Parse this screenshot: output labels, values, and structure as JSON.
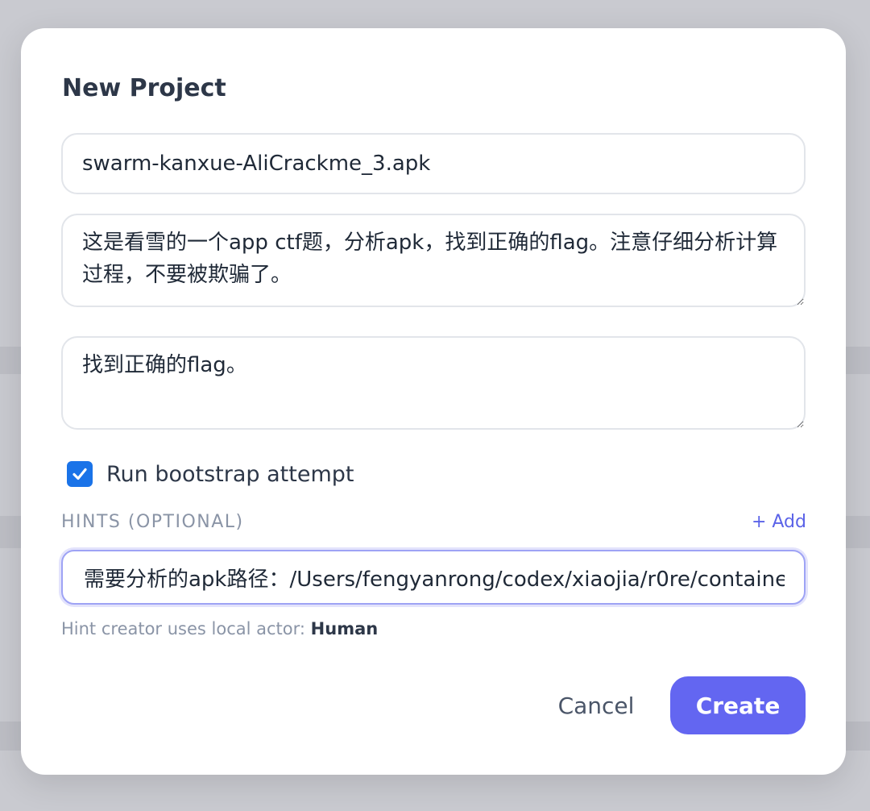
{
  "dialog": {
    "title": "New Project",
    "name_value": "swarm-kanxue-AliCrackme_3.apk",
    "description_value": "这是看雪的一个app ctf题，分析apk，找到正确的flag。注意仔细分析计算过程，不要被欺骗了。",
    "goal_value": "找到正确的flag。",
    "bootstrap": {
      "label": "Run bootstrap attempt",
      "checked": true
    },
    "hints": {
      "header": "HINTS (OPTIONAL)",
      "add_label": "+ Add",
      "hint_value": "需要分析的apk路径：/Users/fengyanrong/codex/xiaojia/r0re/containe",
      "creator_text": "Hint creator uses local actor:",
      "creator_actor": "Human"
    },
    "actions": {
      "cancel_label": "Cancel",
      "create_label": "Create"
    }
  },
  "colors": {
    "accent": "#6366f1",
    "checkbox": "#1a73e8",
    "overlay": "#c9cad0"
  }
}
